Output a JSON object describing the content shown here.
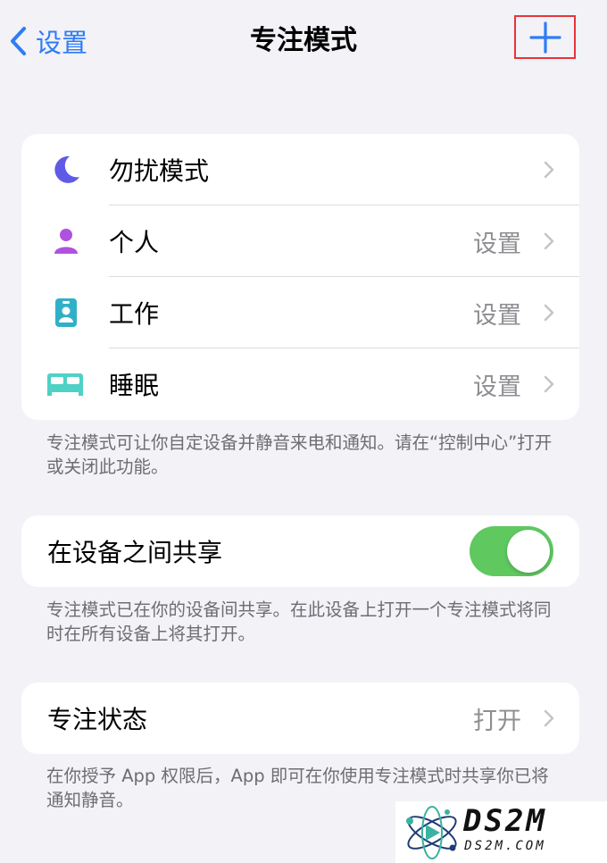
{
  "nav": {
    "back_label": "设置",
    "title": "专注模式"
  },
  "focus_modes": [
    {
      "label": "勿扰模式",
      "value": "",
      "icon": "moon-icon",
      "color": "#5e5ce6"
    },
    {
      "label": "个人",
      "value": "设置",
      "icon": "person-icon",
      "color": "#af52de"
    },
    {
      "label": "工作",
      "value": "设置",
      "icon": "id-badge-icon",
      "color": "#30b0c7"
    },
    {
      "label": "睡眠",
      "value": "设置",
      "icon": "bed-icon",
      "color": "#4fd1c5"
    }
  ],
  "focus_footnote": "专注模式可让你自定设备并静音来电和通知。请在“控制中心”打开或关闭此功能。",
  "share": {
    "label": "在设备之间共享",
    "enabled": true,
    "footnote": "专注模式已在你的设备间共享。在此设备上打开一个专注模式将同时在所有设备上将其打开。"
  },
  "status": {
    "label": "专注状态",
    "value": "打开",
    "footnote": "在你授予 App 权限后，App 即可在你使用专注模式时共享你已将通知静音。"
  },
  "watermark": {
    "brand": "DS2M",
    "domain": "DS2M.COM"
  },
  "colors": {
    "accent": "#2f7cf6",
    "toggle_on": "#5fc85f",
    "highlight_box": "#e8343a"
  }
}
